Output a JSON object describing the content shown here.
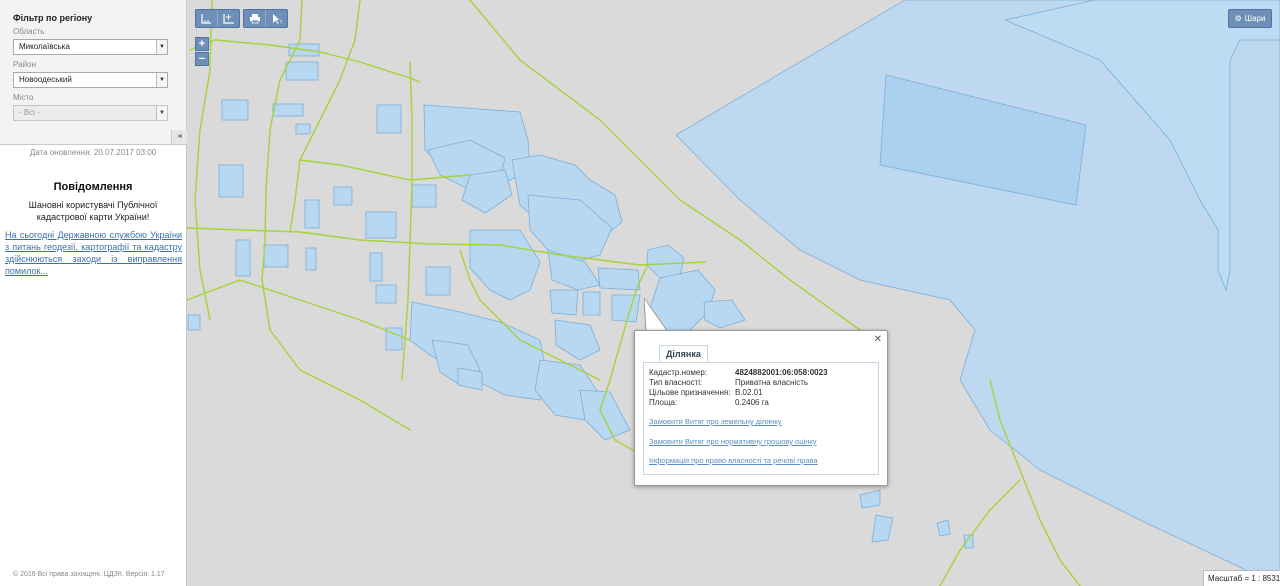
{
  "sidebar": {
    "filter_title": "Фільтр по регіону",
    "region_label": "Область",
    "region_value": "Миколаївська",
    "district_label": "Район",
    "district_value": "Новоодеський",
    "city_label": "Місто",
    "city_value": "- Всі -",
    "collapse_icon": "chevron-left-icon",
    "update_date": "Дата оновлення: 20.07.2017 03:00",
    "message_title": "Повідомлення",
    "message_body": "Шановні користувачі Публічної кадастрової карти України!",
    "message_link": "На сьогодні Державною службою України з питань геодезії, картографії та кадастру здійснюються заходи із виправлення помилок...",
    "copyright": "© 2016 Всі права захищені. ЦДЗК. Версія: 1.17"
  },
  "toolbar": {
    "icons": [
      "measure-distance-icon",
      "measure-area-icon",
      "print-icon",
      "identify-icon"
    ]
  },
  "zoom": {
    "in_label": "+",
    "out_label": "−"
  },
  "layers": {
    "label": "Шари",
    "icon": "gear-icon"
  },
  "scale": {
    "label": "Масштаб = 1 : 8531"
  },
  "colors": {
    "parcel_fill": "#b8d8f2",
    "parcel_stroke": "#7aaed8",
    "road": "#a6d23a",
    "map_bg": "#dadada",
    "button": "#6e8fb8"
  },
  "popup": {
    "tab": "Ділянка",
    "close_icon": "close-icon",
    "rows": [
      {
        "key": "Кадастр.номер:",
        "value": "4824882001:06:058:0023"
      },
      {
        "key": "Тип власності:",
        "value": "Приватна власність"
      },
      {
        "key": "Цільове призначення:",
        "value": "B.02.01"
      },
      {
        "key": "Площа:",
        "value": "0.2406 га"
      }
    ],
    "links": [
      "Замовити Витяг про земельну ділянку",
      "Замовити Витяг про нормативну грошову оцінку",
      "Інформація про право власності та речові права"
    ]
  }
}
